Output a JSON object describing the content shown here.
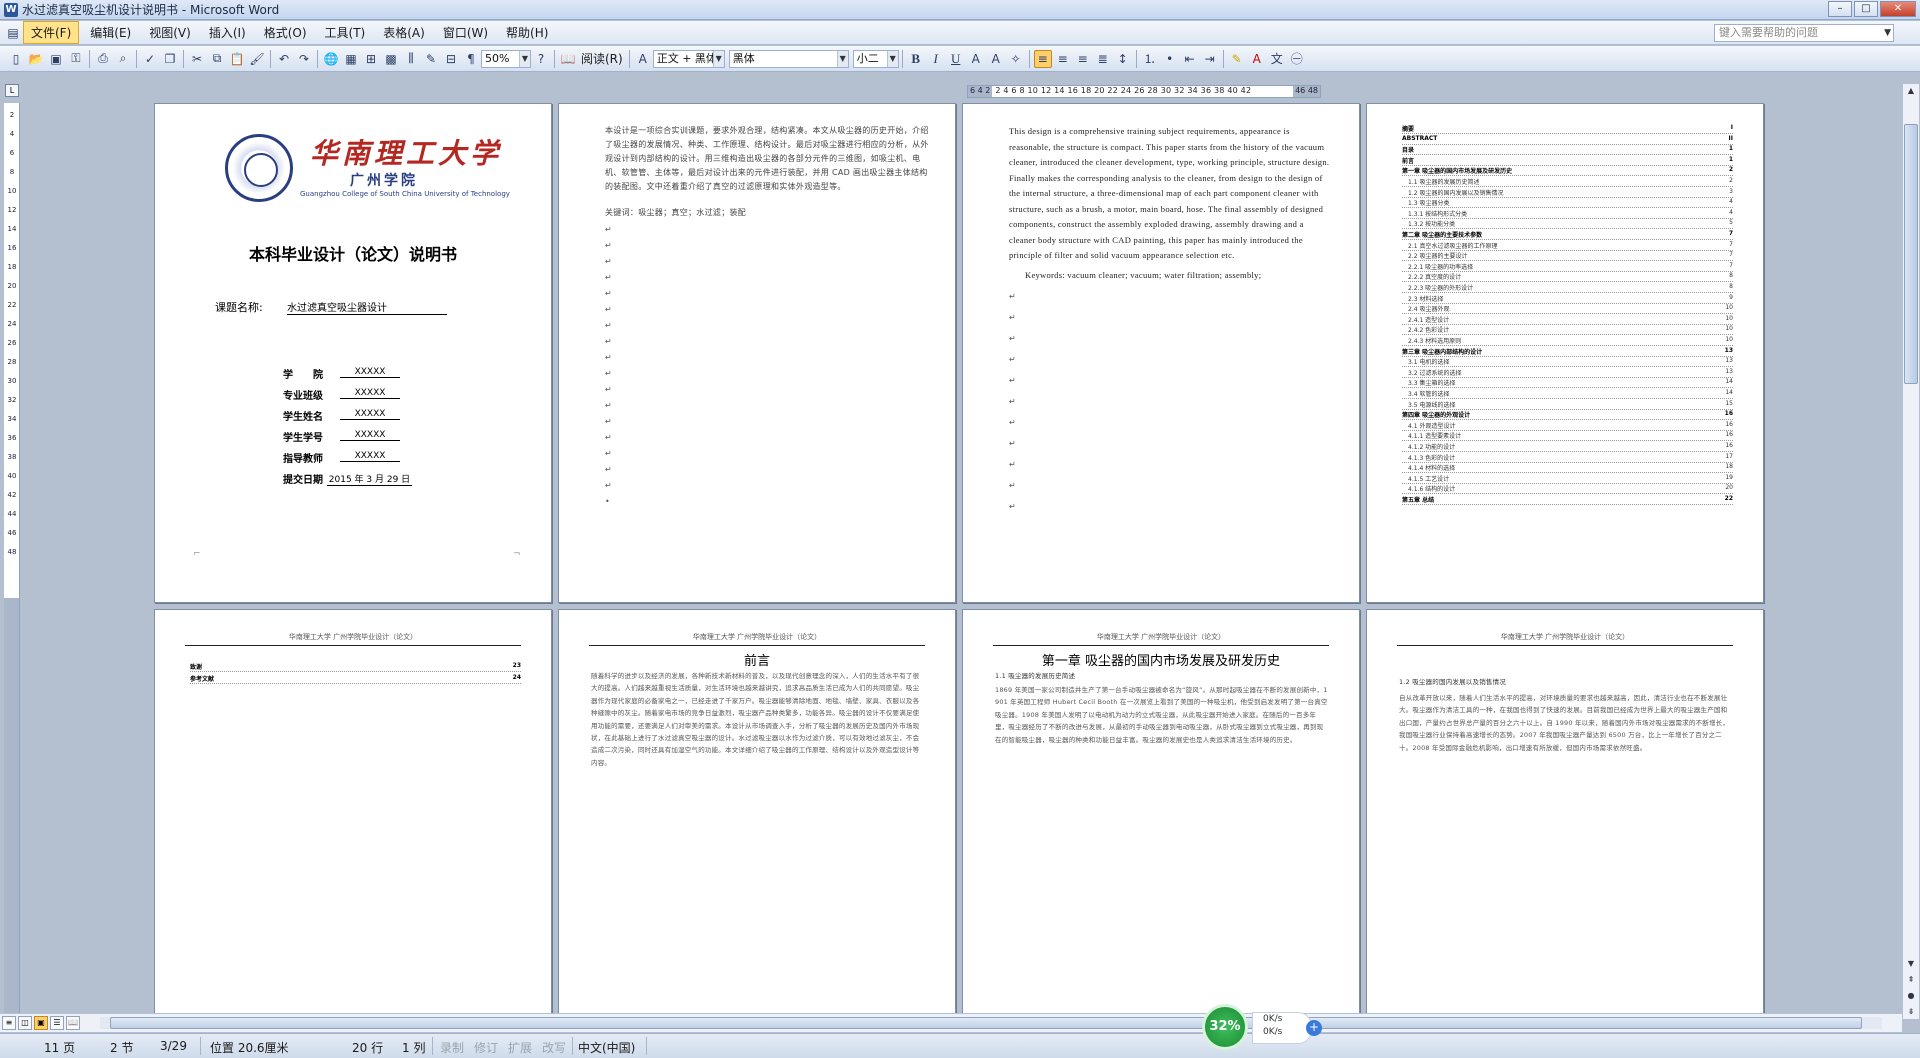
{
  "window": {
    "title": "水过滤真空吸尘机设计说明书 - Microsoft Word",
    "buttons": {
      "minimize": "–",
      "maximize": "□",
      "close": "✕"
    }
  },
  "menubar": {
    "items": [
      "文件(F)",
      "编辑(E)",
      "视图(V)",
      "插入(I)",
      "格式(O)",
      "工具(T)",
      "表格(A)",
      "窗口(W)",
      "帮助(H)"
    ],
    "help_placeholder": "键入需要帮助的问题"
  },
  "toolbar": {
    "zoom": "50%",
    "reading_label": "阅读(R)",
    "style": "正文 + 黑体",
    "font": "黑体",
    "size": "小二",
    "bold_label": "B",
    "italic_label": "I",
    "underline_label": "U"
  },
  "ruler": {
    "left_nums": "6 4 2",
    "mid_nums": "2 4 6 8 10 12 14 16 18 20 22 24 26 28 30 32 34 36 38 40 42",
    "right_nums": "46 48",
    "v_ticks": [
      "2",
      "4",
      "6",
      "8",
      "10",
      "12",
      "14",
      "16",
      "18",
      "20",
      "22",
      "24",
      "26",
      "28",
      "30",
      "32",
      "34",
      "36",
      "38",
      "40",
      "42",
      "44",
      "46",
      "48"
    ]
  },
  "page1": {
    "uni_cn": "华南理工大学",
    "uni_sub": "广州学院",
    "uni_en": "Guangzhou College of South China University of Technology",
    "title": "本科毕业设计（论文）说明书",
    "course_label": "课题名称:",
    "course_value": "水过滤真空吸尘器设计",
    "fields": [
      {
        "label": "学　　院",
        "value": "XXXXX"
      },
      {
        "label": "专业班级",
        "value": "XXXXX"
      },
      {
        "label": "学生姓名",
        "value": "XXXXX"
      },
      {
        "label": "学生学号",
        "value": "XXXXX"
      },
      {
        "label": "指导教师",
        "value": "XXXXX"
      }
    ],
    "date_label": "提交日期",
    "date_value": "2015 年 3 月 29 日"
  },
  "page2": {
    "text": "本设计是一项综合实训课题，要求外观合理，结构紧凑。本文从吸尘器的历史开始，介绍了吸尘器的发展情况、种类、工作原理、结构设计。最后对吸尘器进行相应的分析，从外观设计到内部结构的设计。用三维构造出吸尘器的各部分元件的三维图，如吸尘机、电机、软管管、主体等，最后对设计出来的元件进行装配，并用 CAD 画出吸尘器主体结构的装配图。文中还着重介绍了真空的过滤原理和实体外观造型等。",
    "keywords": "关键词：吸尘器；真空；水过滤；装配"
  },
  "page3": {
    "text": "This design is a comprehensive training subject requirements, appearance is reasonable, the structure is compact. This paper starts from the history of the vacuum cleaner, introduced the cleaner development, type, working principle, structure design. Finally makes the corresponding analysis to the cleaner, from design to the design of the internal structure, a three-dimensional map of each part component cleaner with structure, such as a brush, a motor, main board, hose. The final assembly of designed components, construct the assembly exploded drawing, assembly drawing and a cleaner body structure with CAD painting, this paper has mainly introduced the principle of filter and solid vacuum appearance selection etc.",
    "keywords": "Keywords: vacuum cleaner; vacuum; water filtration; assembly;"
  },
  "page4": {
    "toc": [
      {
        "t": "摘要",
        "p": "I",
        "h": true
      },
      {
        "t": "ABSTRACT",
        "p": "II",
        "h": true
      },
      {
        "t": "目录",
        "p": "1",
        "h": true
      },
      {
        "t": "前言",
        "p": "1",
        "h": true
      },
      {
        "t": "第一章 吸尘器的国内市场发展及研发历史",
        "p": "2",
        "h": true
      },
      {
        "t": "1.1 吸尘器的发展历史简述",
        "p": "2",
        "h": false
      },
      {
        "t": "1.2 吸尘器的国内发展以及销售情况",
        "p": "3",
        "h": false
      },
      {
        "t": "1.3 吸尘器分类",
        "p": "4",
        "h": false
      },
      {
        "t": "1.3.1 按结构形式分类",
        "p": "4",
        "h": false
      },
      {
        "t": "1.3.2 按功能分类",
        "p": "5",
        "h": false
      },
      {
        "t": "第二章 吸尘器的主要技术参数",
        "p": "7",
        "h": true
      },
      {
        "t": "2.1 真空水过滤吸尘器的工作原理",
        "p": "7",
        "h": false
      },
      {
        "t": "2.2 吸尘器的主要设计",
        "p": "7",
        "h": false
      },
      {
        "t": "2.2.1 吸尘器的功率选择",
        "p": "7",
        "h": false
      },
      {
        "t": "2.2.2 真空度的设计",
        "p": "8",
        "h": false
      },
      {
        "t": "2.2.3 吸尘器的外形设计",
        "p": "8",
        "h": false
      },
      {
        "t": "2.3 材料选择",
        "p": "9",
        "h": false
      },
      {
        "t": "2.4 吸尘器外观",
        "p": "10",
        "h": false
      },
      {
        "t": "2.4.1 造型设计",
        "p": "10",
        "h": false
      },
      {
        "t": "2.4.2 色彩设计",
        "p": "10",
        "h": false
      },
      {
        "t": "2.4.3 材料选用原则",
        "p": "10",
        "h": false
      },
      {
        "t": "第三章 吸尘器内部结构的设计",
        "p": "13",
        "h": true
      },
      {
        "t": "3.1 电机的选择",
        "p": "13",
        "h": false
      },
      {
        "t": "3.2 过滤系统的选择",
        "p": "13",
        "h": false
      },
      {
        "t": "3.3 集尘箱的选择",
        "p": "14",
        "h": false
      },
      {
        "t": "3.4 软管的选择",
        "p": "14",
        "h": false
      },
      {
        "t": "3.5 电源线的选择",
        "p": "15",
        "h": false
      },
      {
        "t": "第四章 吸尘器的外观设计",
        "p": "16",
        "h": true
      },
      {
        "t": "4.1 外观造型设计",
        "p": "16",
        "h": false
      },
      {
        "t": "4.1.1 造型要素设计",
        "p": "16",
        "h": false
      },
      {
        "t": "4.1.2 功能的设计",
        "p": "16",
        "h": false
      },
      {
        "t": "4.1.3 色彩的设计",
        "p": "17",
        "h": false
      },
      {
        "t": "4.1.4 材料的选择",
        "p": "18",
        "h": false
      },
      {
        "t": "4.1.5 工艺设计",
        "p": "19",
        "h": false
      },
      {
        "t": "4.1.6 结构的设计",
        "p": "20",
        "h": false
      },
      {
        "t": "第五章 总结",
        "p": "22",
        "h": true
      }
    ]
  },
  "page5": {
    "header": "华南理工大学 广州学院毕业设计（论文）",
    "toc": [
      {
        "t": "致谢",
        "p": "23"
      },
      {
        "t": "参考文献",
        "p": "24"
      }
    ]
  },
  "page6": {
    "header": "华南理工大学 广州学院毕业设计（论文）",
    "heading": "前言",
    "text": "随着科学的进步以及经济的发展，各种新技术新材料的普及，以及现代创意理念的深入，人们的生活水平有了很大的提高。人们越来越重视生活质量，对生活环境也越来越讲究，追求高品质生活已成为人们的共同愿望。吸尘器作为现代家庭的必备家电之一，已经走进了千家万户。吸尘器能够清除地面、地毯、墙壁、家具、衣服以及各种缝隙中的灰尘。随着家电市场的竞争日益激烈，吸尘器产品种类繁多，功能各异。吸尘器的设计不仅要满足使用功能的需要，还要满足人们对审美的需求。本设计从市场调查入手，分析了吸尘器的发展历史及国内外市场现状，在此基础上进行了水过滤真空吸尘器的设计。水过滤吸尘器以水作为过滤介质，可以有效地过滤灰尘，不会造成二次污染，同时还具有加湿空气的功能。本文详细介绍了吸尘器的工作原理、结构设计以及外观造型设计等内容。"
  },
  "page7": {
    "header": "华南理工大学 广州学院毕业设计（论文）",
    "heading": "第一章 吸尘器的国内市场发展及研发历史",
    "sub": "1.1 吸尘器的发展历史简述",
    "text": "1869 年美国一家公司制造并生产了第一台手动吸尘器被命名为“旋风”。从那时起吸尘器在不断的发展创新中，1901 年英国工程师 Hubert Cecil Booth 在一次展览上看到了美国的一种吸尘机，他受到启发发明了第一台真空吸尘器。1908 年美国人发明了以电动机为动力的立式吸尘器，从此吸尘器开始进入家庭。在随后的一百多年里，吸尘器经历了不断的改进与发展，从最初的手动吸尘器到电动吸尘器，从卧式吸尘器到立式吸尘器，再到现在的智能吸尘器，吸尘器的种类和功能日益丰富。吸尘器的发展史也是人类追求清洁生活环境的历史。"
  },
  "page8": {
    "header": "华南理工大学 广州学院毕业设计（论文）",
    "sub": "1.2 吸尘器的国内发展以及销售情况",
    "text": "自从改革开放以来，随着人们生活水平的提高，对环境质量的要求也越来越高，因此，清洁行业也在不断发展壮大。吸尘器作为清洁工具的一种，在我国也得到了快速的发展。目前我国已经成为世界上最大的吸尘器生产国和出口国，产量约占世界总产量的百分之六十以上。自 1990 年以来，随着国内外市场对吸尘器需求的不断增长，我国吸尘器行业保持着高速增长的态势。2007 年我国吸尘器产量达到 6500 万台，比上一年增长了百分之二十。2008 年受国际金融危机影响，出口增速有所放缓，但国内市场需求依然旺盛。"
  },
  "statusbar": {
    "page": "11 页",
    "section": "2 节",
    "pages": "3/29",
    "position": "位置 20.6厘米",
    "line": "20 行",
    "col": "1 列",
    "rec": "录制",
    "trk": "修订",
    "ext": "扩展",
    "ovr": "改写",
    "lang": "中文(中国)"
  },
  "netmeter": {
    "percent": "32%",
    "up": "0K/s",
    "down": "0K/s"
  }
}
